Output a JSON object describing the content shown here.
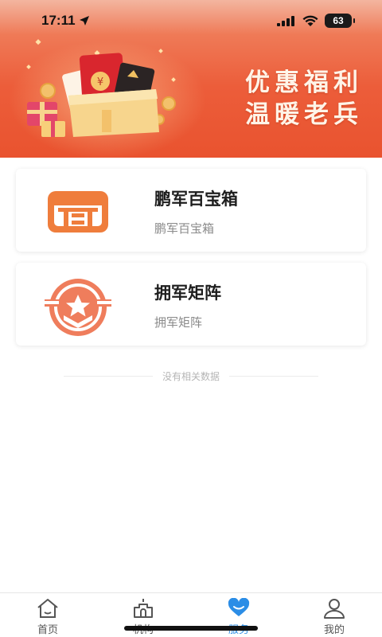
{
  "status_bar": {
    "time": "17:11",
    "battery": "63"
  },
  "banner": {
    "line1": "优惠福利",
    "line2": "温暖老兵"
  },
  "services": [
    {
      "title": "鹏军百宝箱",
      "subtitle": "鹏军百宝箱",
      "icon": "treasure-box-icon"
    },
    {
      "title": "拥军矩阵",
      "subtitle": "拥军矩阵",
      "icon": "star-emblem-icon"
    }
  ],
  "empty_hint": "没有相关数据",
  "tabbar": {
    "tabs": [
      {
        "label": "首页",
        "icon": "home-icon"
      },
      {
        "label": "机构",
        "icon": "institution-icon"
      },
      {
        "label": "服务",
        "icon": "service-heart-icon",
        "active": true
      },
      {
        "label": "我的",
        "icon": "user-icon"
      }
    ]
  },
  "colors": {
    "brand_orange": "#e9532f",
    "icon_orange": "#ef6a3c",
    "active_tab": "#2b8de6"
  }
}
